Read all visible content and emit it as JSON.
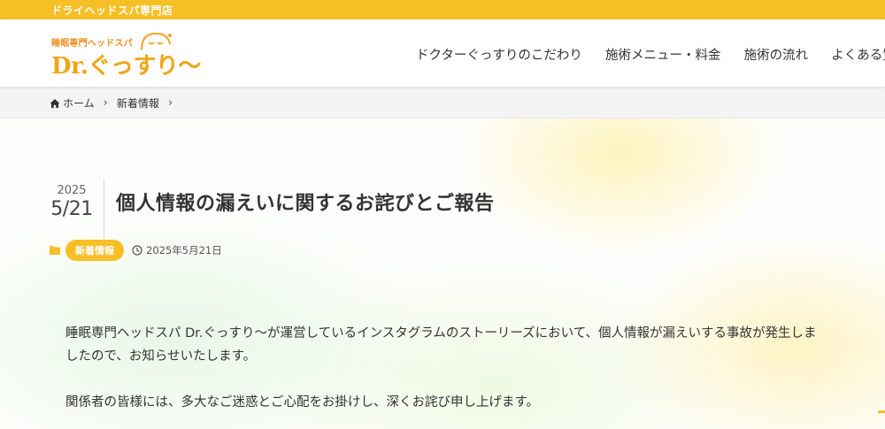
{
  "topbar": {
    "text": "ドライヘッドスパ専門店"
  },
  "logo": {
    "subtitle": "睡眠専門ヘッドスパ",
    "name": "Dr.ぐっすり〜"
  },
  "nav": {
    "items": [
      {
        "label": "ドクターぐっすりのこだわり"
      },
      {
        "label": "施術メニュー・料金"
      },
      {
        "label": "施術の流れ"
      },
      {
        "label": "よくある質問"
      }
    ]
  },
  "breadcrumb": {
    "home": "ホーム",
    "category": "新着情報",
    "separator": "›"
  },
  "post": {
    "year": "2025",
    "month_day": "5/21",
    "title": "個人情報の漏えいに関するお詫びとご報告",
    "category": "新着情報",
    "published": "2025年5月21日",
    "paragraphs": [
      "睡眠専門ヘッドスパ Dr.ぐっすり〜が運営しているインスタグラムのストーリーズにおいて、個人情報が漏えいする事故が発生しましたので、お知らせいたします。",
      "関係者の皆様には、多大なご迷惑とご心配をお掛けし、深くお詫び申し上げます。"
    ]
  },
  "colors": {
    "accent": "#f6bf26",
    "logo": "#f0a51a",
    "text": "#333333"
  },
  "icons": {
    "home": "home-icon",
    "folder": "folder-icon",
    "clock": "clock-icon"
  }
}
